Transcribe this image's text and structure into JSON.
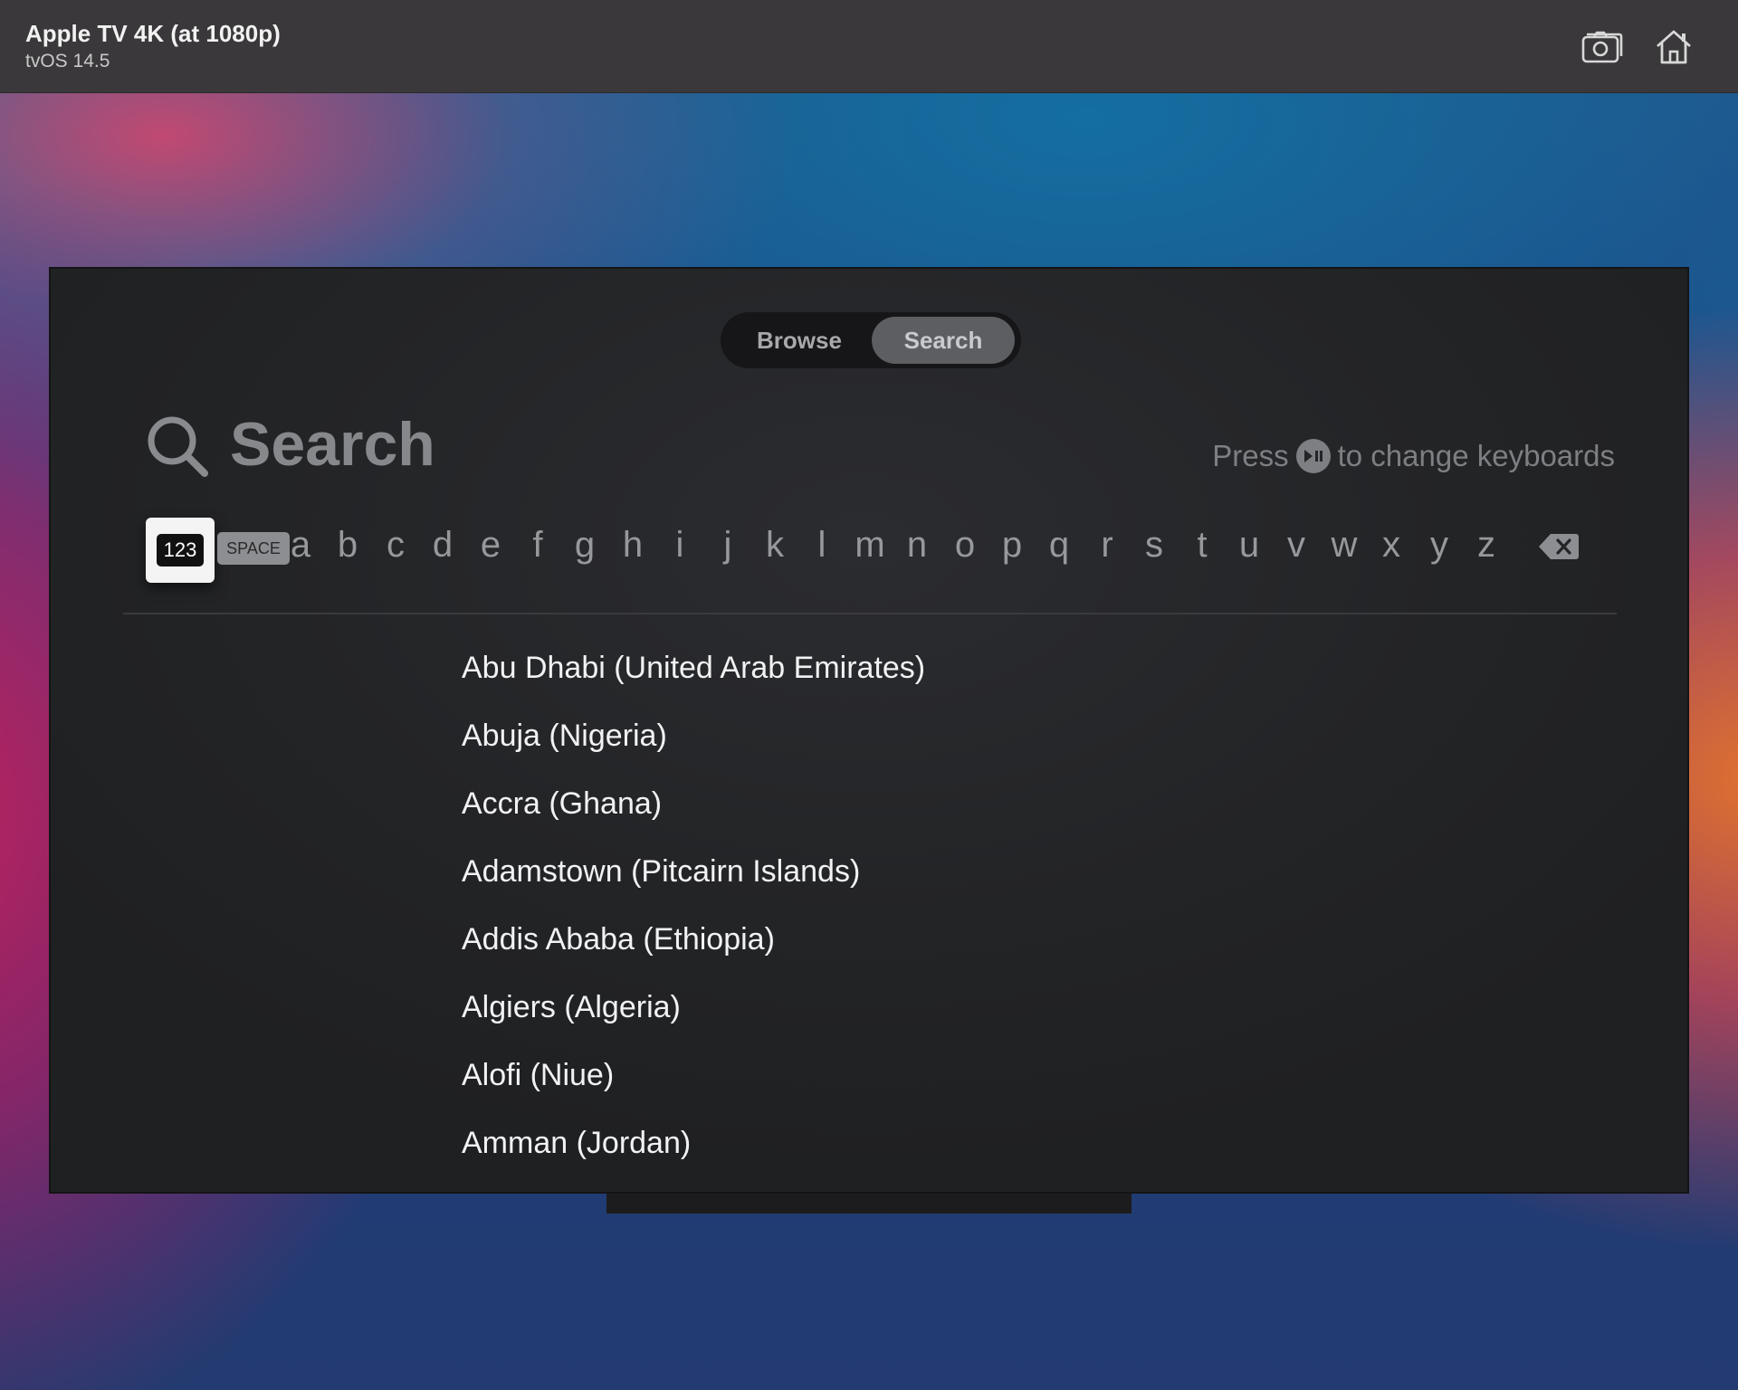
{
  "simulator": {
    "title": "Apple TV 4K (at 1080p)",
    "subtitle": "tvOS 14.5",
    "buttons": [
      {
        "name": "screenshot",
        "icon": "camera-icon"
      },
      {
        "name": "home",
        "icon": "home-icon"
      }
    ]
  },
  "tabs": [
    {
      "label": "Browse",
      "selected": false
    },
    {
      "label": "Search",
      "selected": true
    }
  ],
  "search": {
    "placeholder": "Search",
    "hint_prefix": "Press",
    "hint_icon": "play-pause-icon",
    "hint_suffix": "to change keyboards"
  },
  "keyboard": {
    "mode_key": "123",
    "space_key": "SPACE",
    "letters": [
      "a",
      "b",
      "c",
      "d",
      "e",
      "f",
      "g",
      "h",
      "i",
      "j",
      "k",
      "l",
      "m",
      "n",
      "o",
      "p",
      "q",
      "r",
      "s",
      "t",
      "u",
      "v",
      "w",
      "x",
      "y",
      "z"
    ],
    "delete_icon": "backspace-icon",
    "focused_key": "123"
  },
  "results": [
    "Abu Dhabi (United Arab Emirates)",
    "Abuja (Nigeria)",
    "Accra (Ghana)",
    "Adamstown (Pitcairn Islands)",
    "Addis Ababa (Ethiopia)",
    "Algiers (Algeria)",
    "Alofi (Niue)",
    "Amman (Jordan)"
  ],
  "colors": {
    "tv_background": "#232426",
    "titlebar": "#3a383a",
    "selected_tab": "#5d5e62",
    "focus_key": "#f4f4f4"
  }
}
